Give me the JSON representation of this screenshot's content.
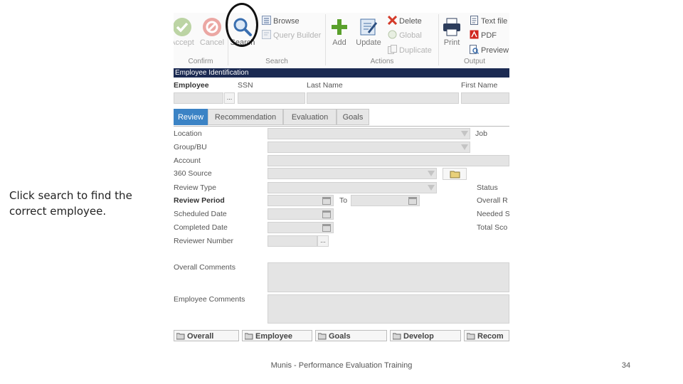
{
  "caption": "Click search to find the\ncorrect employee.",
  "footer": "Munis - Performance Evaluation Training",
  "page_number": "34",
  "ribbon": {
    "accept": "Accept",
    "cancel": "Cancel",
    "search": "Search",
    "browse": "Browse",
    "query_builder": "Query Builder",
    "add": "Add",
    "update": "Update",
    "delete": "Delete",
    "global": "Global",
    "duplicate": "Duplicate",
    "print": "Print",
    "text_file": "Text file",
    "pdf": "PDF",
    "preview": "Preview",
    "groups": {
      "confirm": "Confirm",
      "search": "Search",
      "actions": "Actions",
      "output": "Output"
    }
  },
  "section_title": "Employee Identification",
  "id_fields": {
    "employee": "Employee",
    "ssn": "SSN",
    "last_name": "Last Name",
    "first_name": "First Name",
    "ellipsis": "..."
  },
  "tabs": [
    "Review",
    "Recommendation",
    "Evaluation",
    "Goals"
  ],
  "form": {
    "location": "Location",
    "group_bu": "Group/BU",
    "account": "Account",
    "source_360": "360 Source",
    "review_type": "Review Type",
    "review_period": "Review Period",
    "to": "To",
    "scheduled_date": "Scheduled Date",
    "completed_date": "Completed Date",
    "reviewer_number": "Reviewer Number",
    "ellipsis": "...",
    "job": "Job",
    "status": "Status",
    "overall_r": "Overall R",
    "needed": "Needed S",
    "total_sco": "Total Sco",
    "overall_comments": "Overall Comments",
    "employee_comments": "Employee Comments"
  },
  "bottom_buttons": [
    "Overall",
    "Employee",
    "Goals",
    "Develop",
    "Recom"
  ],
  "colors": {
    "accent": "#3b83c5",
    "header_bar": "#1b2a52",
    "add_green": "#5aa02c",
    "delete_red": "#d43b2a"
  }
}
